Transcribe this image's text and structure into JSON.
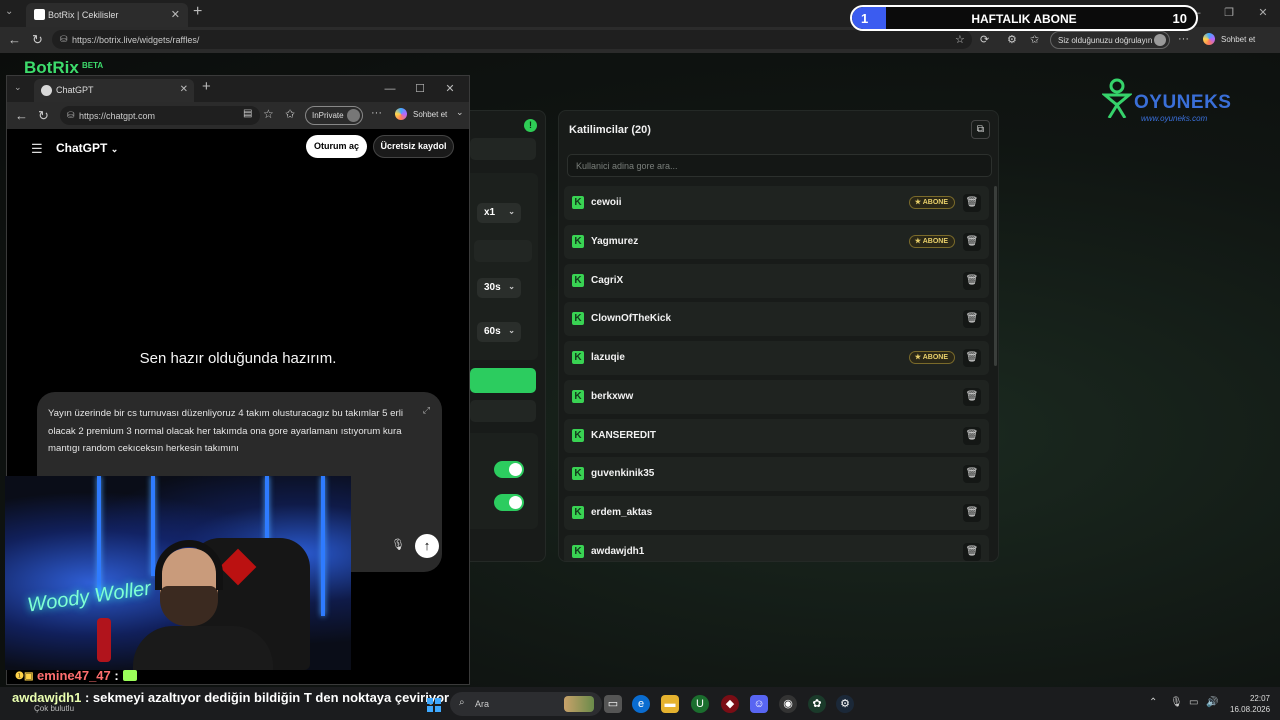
{
  "outer_browser": {
    "tab_title": "BotRix | Cekilisler",
    "url": "https://botrix.live/widgets/raffles/",
    "verify_text": "Siz olduğunuzu doğrulayın",
    "copilot_label": "Sohbet et"
  },
  "weekly_sub": {
    "title": "HAFTALIK ABONE",
    "current": "1",
    "goal": "10",
    "progress": 0.1,
    "bar_color": "#3b5cf0"
  },
  "botrix": {
    "logo": "BotRix",
    "beta": "BETA"
  },
  "overlay_logo": {
    "name": "OYUNEKS",
    "url": "www.oyuneks.com",
    "color": "#3a6fd8",
    "icon_color": "#36d36b"
  },
  "settings": {
    "status_icon": "!",
    "multiplier": "x1",
    "duration_1": "30s",
    "duration_2": "60s",
    "accent": "#2ccc5f"
  },
  "participants": {
    "title": "Katilimcilar (20)",
    "search_placeholder": "Kullanici adina gore ara...",
    "badge_label": "ABONE",
    "items": [
      {
        "name": "cewoii",
        "subscriber": true
      },
      {
        "name": "Yagmurez",
        "subscriber": true
      },
      {
        "name": "CagriX",
        "subscriber": false
      },
      {
        "name": "ClownOfTheKick",
        "subscriber": false
      },
      {
        "name": "lazuqie",
        "subscriber": true
      },
      {
        "name": "berkxww",
        "subscriber": false
      },
      {
        "name": "KANSEREDIT",
        "subscriber": false
      },
      {
        "name": "guvenkinik35",
        "subscriber": false
      },
      {
        "name": "erdem_aktas",
        "subscriber": false
      },
      {
        "name": "awdawjdh1",
        "subscriber": false
      }
    ]
  },
  "inner_browser": {
    "tab_title": "ChatGPT",
    "url": "https://chatgpt.com",
    "inprivate": "InPrivate",
    "copilot_label": "Sohbet et"
  },
  "chatgpt": {
    "brand": "ChatGPT",
    "login": "Oturum aç",
    "signup": "Ücretsiz kaydol",
    "hero": "Sen hazır olduğunda hazırım.",
    "prompt": "Yayın üzerinde bir cs turnuvası düzenliyoruz 4 takım olusturacagız bu takımlar 5 erli olacak 2 premium 3 normal olacak her takımda ona gore ayarlamanı ıstıyorum kura mantıgı random cekıceksın herkesin takımını"
  },
  "webcam": {
    "neon_sign": "Woody Woller"
  },
  "chat": {
    "line1_user": "emine47_47",
    "line2_user": "awdawjdh1",
    "line2_message": ": sekmeyi azaltıyor dediğin bildiğin T den noktaya çeviriyor",
    "line2_sub": "Çok bulutlu"
  },
  "taskbar": {
    "search_label": "Ara",
    "time": "22:07",
    "date": "16.08.2026"
  }
}
